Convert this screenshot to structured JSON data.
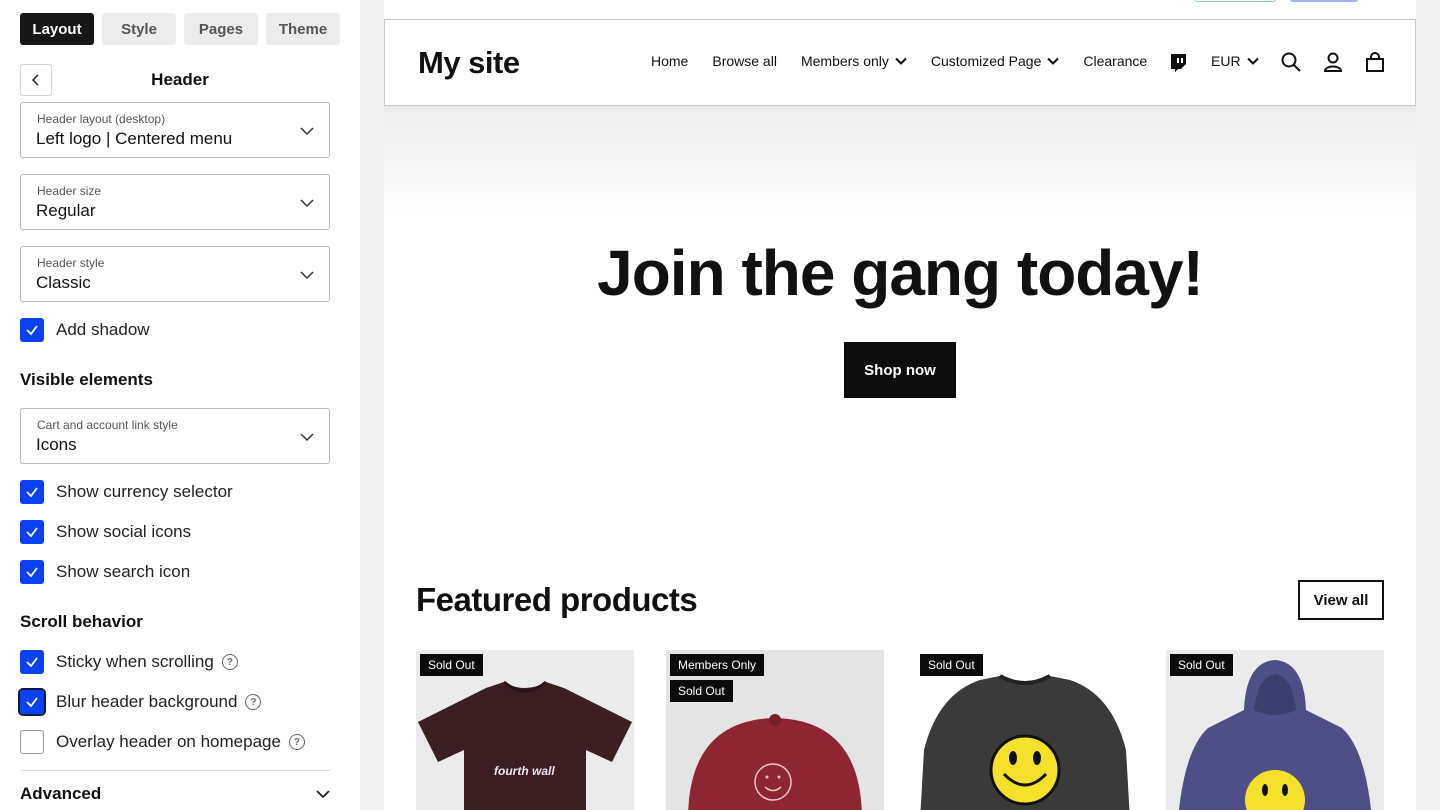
{
  "panel": {
    "tabs": [
      {
        "label": "Layout",
        "active": true
      },
      {
        "label": "Style",
        "active": false
      },
      {
        "label": "Pages",
        "active": false
      },
      {
        "label": "Theme",
        "active": false
      }
    ],
    "title": "Header",
    "selects": {
      "layout": {
        "label": "Header layout (desktop)",
        "value": "Left logo | Centered menu"
      },
      "size": {
        "label": "Header size",
        "value": "Regular"
      },
      "style": {
        "label": "Header style",
        "value": "Classic"
      },
      "cart_style": {
        "label": "Cart and account link style",
        "value": "Icons"
      }
    },
    "add_shadow": {
      "label": "Add shadow",
      "checked": true
    },
    "visible_elements": {
      "heading": "Visible elements",
      "currency": {
        "label": "Show currency selector",
        "checked": true
      },
      "social": {
        "label": "Show social icons",
        "checked": true
      },
      "search": {
        "label": "Show search icon",
        "checked": true
      }
    },
    "scroll": {
      "heading": "Scroll behavior",
      "sticky": {
        "label": "Sticky when scrolling",
        "checked": true
      },
      "blur": {
        "label": "Blur header background",
        "checked": true
      },
      "overlay": {
        "label": "Overlay header on homepage",
        "checked": false
      }
    },
    "help_glyph": "?",
    "advanced": "Advanced",
    "colors": {
      "accent": "#0b41f5",
      "active_tab": "#171717"
    }
  },
  "preview": {
    "logo": "My site",
    "nav": [
      {
        "label": "Home",
        "dropdown": false
      },
      {
        "label": "Browse all",
        "dropdown": false
      },
      {
        "label": "Members only",
        "dropdown": true
      },
      {
        "label": "Customized Page",
        "dropdown": true
      },
      {
        "label": "Clearance",
        "dropdown": false
      }
    ],
    "currency": "EUR",
    "icons": [
      "twitch-icon",
      "search-icon",
      "account-icon",
      "cart-icon"
    ],
    "hero": {
      "title": "Join the gang today!",
      "button": "Shop now"
    },
    "featured": {
      "title": "Featured products",
      "view_all": "View all"
    },
    "products": [
      {
        "badges": [
          "Sold Out"
        ],
        "print": "fourth wall"
      },
      {
        "badges": [
          "Members Only",
          "Sold Out"
        ]
      },
      {
        "badges": [
          "Sold Out"
        ]
      },
      {
        "badges": [
          "Sold Out"
        ]
      }
    ],
    "colors": {
      "tee": "#3a1e22",
      "cap": "#8e2532",
      "sweater": "#3a3a3a",
      "hoodie": "#4d4f86",
      "smiley": "#f5e02c"
    }
  }
}
